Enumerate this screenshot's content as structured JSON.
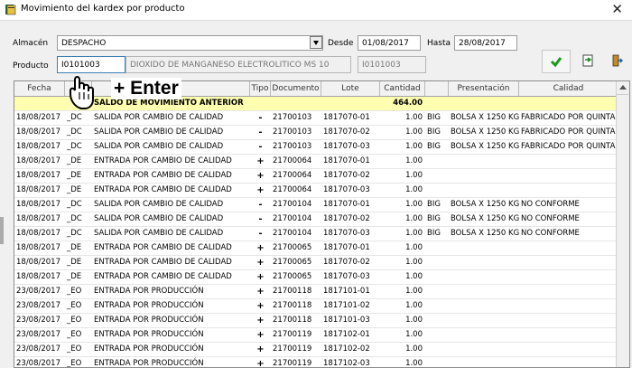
{
  "window": {
    "title": "Movimiento del kardex por producto",
    "close": "✕"
  },
  "filters": {
    "almacen_label": "Almacén",
    "almacen_value": "DESPACHO",
    "desde_label": "Desde",
    "desde_value": "01/08/2017",
    "hasta_label": "Hasta",
    "hasta_value": "28/08/2017",
    "producto_label": "Producto",
    "producto_code": "I0101003",
    "producto_desc": "DIOXIDO DE MANGANESO ELECTROLITICO MS 10",
    "producto_code_ro": "I0101003"
  },
  "hint": {
    "text": "+ Enter"
  },
  "colors": {
    "saldo_row": "#ffffb0",
    "ok_green": "#1a9a1a"
  },
  "grid": {
    "columns": [
      "Fecha",
      "",
      "",
      "Tipo",
      "Documento",
      "Lote",
      "Cantidad",
      "",
      "Presentación",
      "Calidad"
    ],
    "rows": [
      {
        "fecha": "",
        "cod": "",
        "desc": "SALDO DE MOVIMIENTO ANTERIOR",
        "tipo": "",
        "doc": "",
        "lote": "",
        "cant": "464.00",
        "u": "",
        "pres": "",
        "cal": "",
        "saldo": true
      },
      {
        "fecha": "18/08/2017",
        "cod": "_DC",
        "desc": "SALIDA POR CAMBIO DE CALIDAD",
        "tipo": "-",
        "doc": "21700103",
        "lote": "1817070-01",
        "cant": "1.00",
        "u": "BIG",
        "pres": "BOLSA X 1250 KG",
        "cal": "FABRICADO POR QUINTAL"
      },
      {
        "fecha": "18/08/2017",
        "cod": "_DC",
        "desc": "SALIDA POR CAMBIO DE CALIDAD",
        "tipo": "-",
        "doc": "21700103",
        "lote": "1817070-02",
        "cant": "1.00",
        "u": "BIG",
        "pres": "BOLSA X 1250 KG",
        "cal": "FABRICADO POR QUINTAL"
      },
      {
        "fecha": "18/08/2017",
        "cod": "_DC",
        "desc": "SALIDA POR CAMBIO DE CALIDAD",
        "tipo": "-",
        "doc": "21700103",
        "lote": "1817070-03",
        "cant": "1.00",
        "u": "BIG",
        "pres": "BOLSA X 1250 KG",
        "cal": "FABRICADO POR QUINTAL"
      },
      {
        "fecha": "18/08/2017",
        "cod": "_DE",
        "desc": "ENTRADA POR CAMBIO DE CALIDAD",
        "tipo": "+",
        "doc": "21700064",
        "lote": "1817070-01",
        "cant": "1.00",
        "u": "",
        "pres": "",
        "cal": ""
      },
      {
        "fecha": "18/08/2017",
        "cod": "_DE",
        "desc": "ENTRADA POR CAMBIO DE CALIDAD",
        "tipo": "+",
        "doc": "21700064",
        "lote": "1817070-02",
        "cant": "1.00",
        "u": "",
        "pres": "",
        "cal": ""
      },
      {
        "fecha": "18/08/2017",
        "cod": "_DE",
        "desc": "ENTRADA POR CAMBIO DE CALIDAD",
        "tipo": "+",
        "doc": "21700064",
        "lote": "1817070-03",
        "cant": "1.00",
        "u": "",
        "pres": "",
        "cal": ""
      },
      {
        "fecha": "18/08/2017",
        "cod": "_DC",
        "desc": "SALIDA POR CAMBIO DE CALIDAD",
        "tipo": "-",
        "doc": "21700104",
        "lote": "1817070-01",
        "cant": "1.00",
        "u": "BIG",
        "pres": "BOLSA X 1250 KG",
        "cal": "NO CONFORME"
      },
      {
        "fecha": "18/08/2017",
        "cod": "_DC",
        "desc": "SALIDA POR CAMBIO DE CALIDAD",
        "tipo": "-",
        "doc": "21700104",
        "lote": "1817070-02",
        "cant": "1.00",
        "u": "BIG",
        "pres": "BOLSA X 1250 KG",
        "cal": "NO CONFORME"
      },
      {
        "fecha": "18/08/2017",
        "cod": "_DC",
        "desc": "SALIDA POR CAMBIO DE CALIDAD",
        "tipo": "-",
        "doc": "21700104",
        "lote": "1817070-03",
        "cant": "1.00",
        "u": "BIG",
        "pres": "BOLSA X 1250 KG",
        "cal": "NO CONFORME"
      },
      {
        "fecha": "18/08/2017",
        "cod": "_DE",
        "desc": "ENTRADA POR CAMBIO DE CALIDAD",
        "tipo": "+",
        "doc": "21700065",
        "lote": "1817070-01",
        "cant": "1.00",
        "u": "",
        "pres": "",
        "cal": ""
      },
      {
        "fecha": "18/08/2017",
        "cod": "_DE",
        "desc": "ENTRADA POR CAMBIO DE CALIDAD",
        "tipo": "+",
        "doc": "21700065",
        "lote": "1817070-02",
        "cant": "1.00",
        "u": "",
        "pres": "",
        "cal": ""
      },
      {
        "fecha": "18/08/2017",
        "cod": "_DE",
        "desc": "ENTRADA POR CAMBIO DE CALIDAD",
        "tipo": "+",
        "doc": "21700065",
        "lote": "1817070-03",
        "cant": "1.00",
        "u": "",
        "pres": "",
        "cal": ""
      },
      {
        "fecha": "23/08/2017",
        "cod": "_EO",
        "desc": "ENTRADA POR PRODUCCIÓN",
        "tipo": "+",
        "doc": "21700118",
        "lote": "1817101-01",
        "cant": "1.00",
        "u": "",
        "pres": "",
        "cal": ""
      },
      {
        "fecha": "23/08/2017",
        "cod": "_EO",
        "desc": "ENTRADA POR PRODUCCIÓN",
        "tipo": "+",
        "doc": "21700118",
        "lote": "1817101-02",
        "cant": "1.00",
        "u": "",
        "pres": "",
        "cal": ""
      },
      {
        "fecha": "23/08/2017",
        "cod": "_EO",
        "desc": "ENTRADA POR PRODUCCIÓN",
        "tipo": "+",
        "doc": "21700118",
        "lote": "1817101-03",
        "cant": "1.00",
        "u": "",
        "pres": "",
        "cal": ""
      },
      {
        "fecha": "23/08/2017",
        "cod": "_EO",
        "desc": "ENTRADA POR PRODUCCIÓN",
        "tipo": "+",
        "doc": "21700119",
        "lote": "1817102-01",
        "cant": "1.00",
        "u": "",
        "pres": "",
        "cal": ""
      },
      {
        "fecha": "23/08/2017",
        "cod": "_EO",
        "desc": "ENTRADA POR PRODUCCIÓN",
        "tipo": "+",
        "doc": "21700119",
        "lote": "1817102-02",
        "cant": "1.00",
        "u": "",
        "pres": "",
        "cal": ""
      },
      {
        "fecha": "23/08/2017",
        "cod": "_EO",
        "desc": "ENTRADA POR PRODUCCIÓN",
        "tipo": "+",
        "doc": "21700119",
        "lote": "1817102-03",
        "cant": "1.00",
        "u": "",
        "pres": "",
        "cal": ""
      }
    ]
  }
}
